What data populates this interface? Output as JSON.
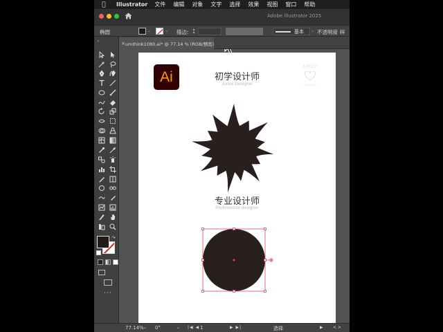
{
  "menubar": {
    "app_name": "Illustrator",
    "items": [
      "文件",
      "编辑",
      "对象",
      "文字",
      "选择",
      "效果",
      "视图",
      "窗口",
      "帮助"
    ]
  },
  "window": {
    "title": "Adobe Illustrator 2025"
  },
  "control_bar": {
    "selection_label": "椭圆",
    "stroke_label": "描边:",
    "brush_label": "基本",
    "opacity_label": "不透明度",
    "style_label": "样式"
  },
  "document_tab": {
    "title": "umthink1080.ai* @ 77.14 % (RGB/预览)"
  },
  "artboard": {
    "logo_text": "Ai",
    "title_1": "初学设计师",
    "subtitle_1": "Junior Designer",
    "title_2": "专业设计师",
    "subtitle_2": "Professional designer",
    "watermark_title": "木博设计",
    "watermark_sub": "UMTHINK",
    "shape_color": "#2a1f1f",
    "selection_color": "#e0456a"
  },
  "status_bar": {
    "zoom": "77.14%",
    "angle": "0°",
    "artboard_number": "1",
    "status": "选择"
  },
  "colors": {
    "logo_bg": "#330000",
    "logo_text": "#ff9a00",
    "ui_panel": "#535353",
    "ui_dark": "#424242"
  },
  "icons": [
    "apple-icon",
    "home-icon",
    "selection-tool-icon",
    "direct-selection-tool-icon",
    "pen-tool-icon",
    "type-tool-icon",
    "line-tool-icon",
    "ellipse-tool-icon",
    "brush-tool-icon",
    "eraser-tool-icon",
    "rotate-tool-icon",
    "scale-tool-icon",
    "gradient-tool-icon",
    "eyedropper-tool-icon",
    "hand-tool-icon",
    "zoom-tool-icon",
    "cursor-icon",
    "heart-icon"
  ]
}
